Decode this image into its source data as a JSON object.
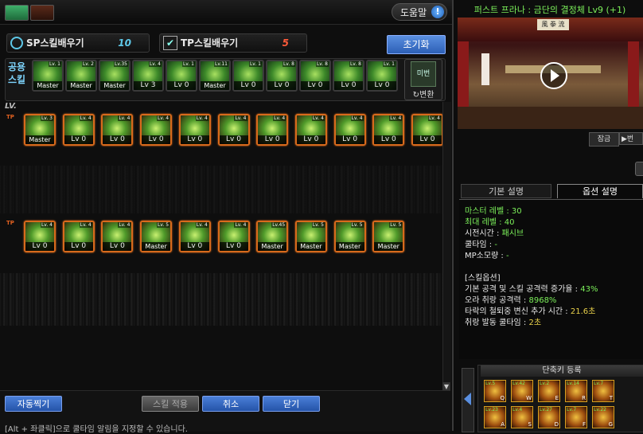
{
  "help": {
    "label": "도움말",
    "icon_text": "!"
  },
  "sp": {
    "label": "SP스킬배우기",
    "value": "10"
  },
  "tp": {
    "label": "TP스킬배우기",
    "value": "5"
  },
  "reset_label": "초기화",
  "shared": {
    "label_line1": "공용",
    "label_line2": "스킬",
    "skills": [
      {
        "badge": "Master",
        "lvtag": "Lv. 1"
      },
      {
        "badge": "Master",
        "lvtag": "Lv. 2"
      },
      {
        "badge": "Master",
        "lvtag": "Lv.35"
      },
      {
        "badge": "Lv 3",
        "lvtag": "Lv. 4"
      },
      {
        "badge": "Lv 0",
        "lvtag": "Lv. 1"
      },
      {
        "badge": "Master",
        "lvtag": "Lv.11"
      },
      {
        "badge": "Lv 0",
        "lvtag": "Lv. 1"
      },
      {
        "badge": "Lv 0",
        "lvtag": "Lv. 8"
      },
      {
        "badge": "Lv 0",
        "lvtag": "Lv. 8"
      },
      {
        "badge": "Lv 0",
        "lvtag": "Lv. 8"
      },
      {
        "badge": "Lv 0",
        "lvtag": "Lv. 1"
      }
    ],
    "convert_label": "↻변환",
    "convert_icon_text": "미번"
  },
  "lv_label": "LV.",
  "tp_mark": "TP",
  "row1": [
    {
      "badge": "Master",
      "lvtag": "Lv. 3"
    },
    {
      "badge": "Lv 0",
      "lvtag": "Lv. 4"
    },
    {
      "badge": "Lv 0",
      "lvtag": "Lv. 4"
    },
    {
      "badge": "Lv 0",
      "lvtag": "Lv. 4"
    },
    {
      "badge": "Lv 0",
      "lvtag": "Lv. 4"
    },
    {
      "badge": "Lv 0",
      "lvtag": "Lv. 4"
    },
    {
      "badge": "Lv 0",
      "lvtag": "Lv. 4"
    },
    {
      "badge": "Lv 0",
      "lvtag": "Lv. 4"
    },
    {
      "badge": "Lv 0",
      "lvtag": "Lv. 4"
    },
    {
      "badge": "Lv 0",
      "lvtag": "Lv. 4"
    },
    {
      "badge": "Lv 0",
      "lvtag": "Lv. 4"
    }
  ],
  "row2": [
    {
      "badge": "Lv 0",
      "lvtag": "Lv. 4"
    },
    {
      "badge": "Lv 0",
      "lvtag": "Lv. 4"
    },
    {
      "badge": "Lv 0",
      "lvtag": "Lv. 4"
    },
    {
      "badge": "Master",
      "lvtag": "Lv. 5"
    },
    {
      "badge": "Lv 0",
      "lvtag": "Lv. 4"
    },
    {
      "badge": "Lv 0",
      "lvtag": "Lv. 4"
    },
    {
      "badge": "Master",
      "lvtag": "Lv.45"
    },
    {
      "badge": "Master",
      "lvtag": "Lv. 5"
    },
    {
      "badge": "Master",
      "lvtag": "Lv. 5"
    },
    {
      "badge": "Master",
      "lvtag": "Lv. 5"
    }
  ],
  "buttons": {
    "auto": "자동찍기",
    "apply": "스킬 적용",
    "cancel": "취소",
    "close": "닫기"
  },
  "hint": "[Alt + 좌클릭]으로 쿨타임 알림을 지정할 수 있습니다.",
  "video": {
    "title": "퍼스트 프라나 : 금단의 결정체 Lv9 (+1)",
    "sign_text": "風 拳 流"
  },
  "lock_label": "잠금",
  "next_label": "▶번",
  "tabs": {
    "basic": "기본 설명",
    "option": "옵션 설명"
  },
  "desc": {
    "master_level": {
      "label": "마스터 레벨 : ",
      "value": "30"
    },
    "max_level": {
      "label": "최대 레벨 : ",
      "value": "40"
    },
    "cast_time": {
      "label": "시전시간 : ",
      "value": "패시브"
    },
    "cooldown": {
      "label": "쿨타임 : ",
      "value": "-"
    },
    "mp": {
      "label": "MP소모량 : ",
      "value": "-"
    },
    "option_header": "[스킬옵션]",
    "opt1": {
      "label": "기본 공격 및 스킬 공격력 증가율 : ",
      "value": "43%"
    },
    "opt2": {
      "label": "오라 취랑 공격력 : ",
      "value": "8968%"
    },
    "opt3": {
      "label": "타락의 철퇴중 변신 추가 시간 : ",
      "value": "21.6초"
    },
    "opt4": {
      "label": "취랑 발동 쿨타임 : ",
      "value": "2초"
    }
  },
  "hotkeys": {
    "title": "단축키 등록",
    "slots": [
      {
        "lv": "Lv.5",
        "key": "Q"
      },
      {
        "lv": "Lv.42",
        "key": "W"
      },
      {
        "lv": "Lv.2",
        "key": "E"
      },
      {
        "lv": "Lv.14",
        "key": "R"
      },
      {
        "lv": "Lv.7",
        "key": "T"
      },
      {
        "lv": "Lv.23",
        "key": "A"
      },
      {
        "lv": "Lv.4",
        "key": "S"
      },
      {
        "lv": "Lv.27",
        "key": "D"
      },
      {
        "lv": "Lv.7",
        "key": "F"
      },
      {
        "lv": "Lv.22",
        "key": "G"
      }
    ]
  }
}
